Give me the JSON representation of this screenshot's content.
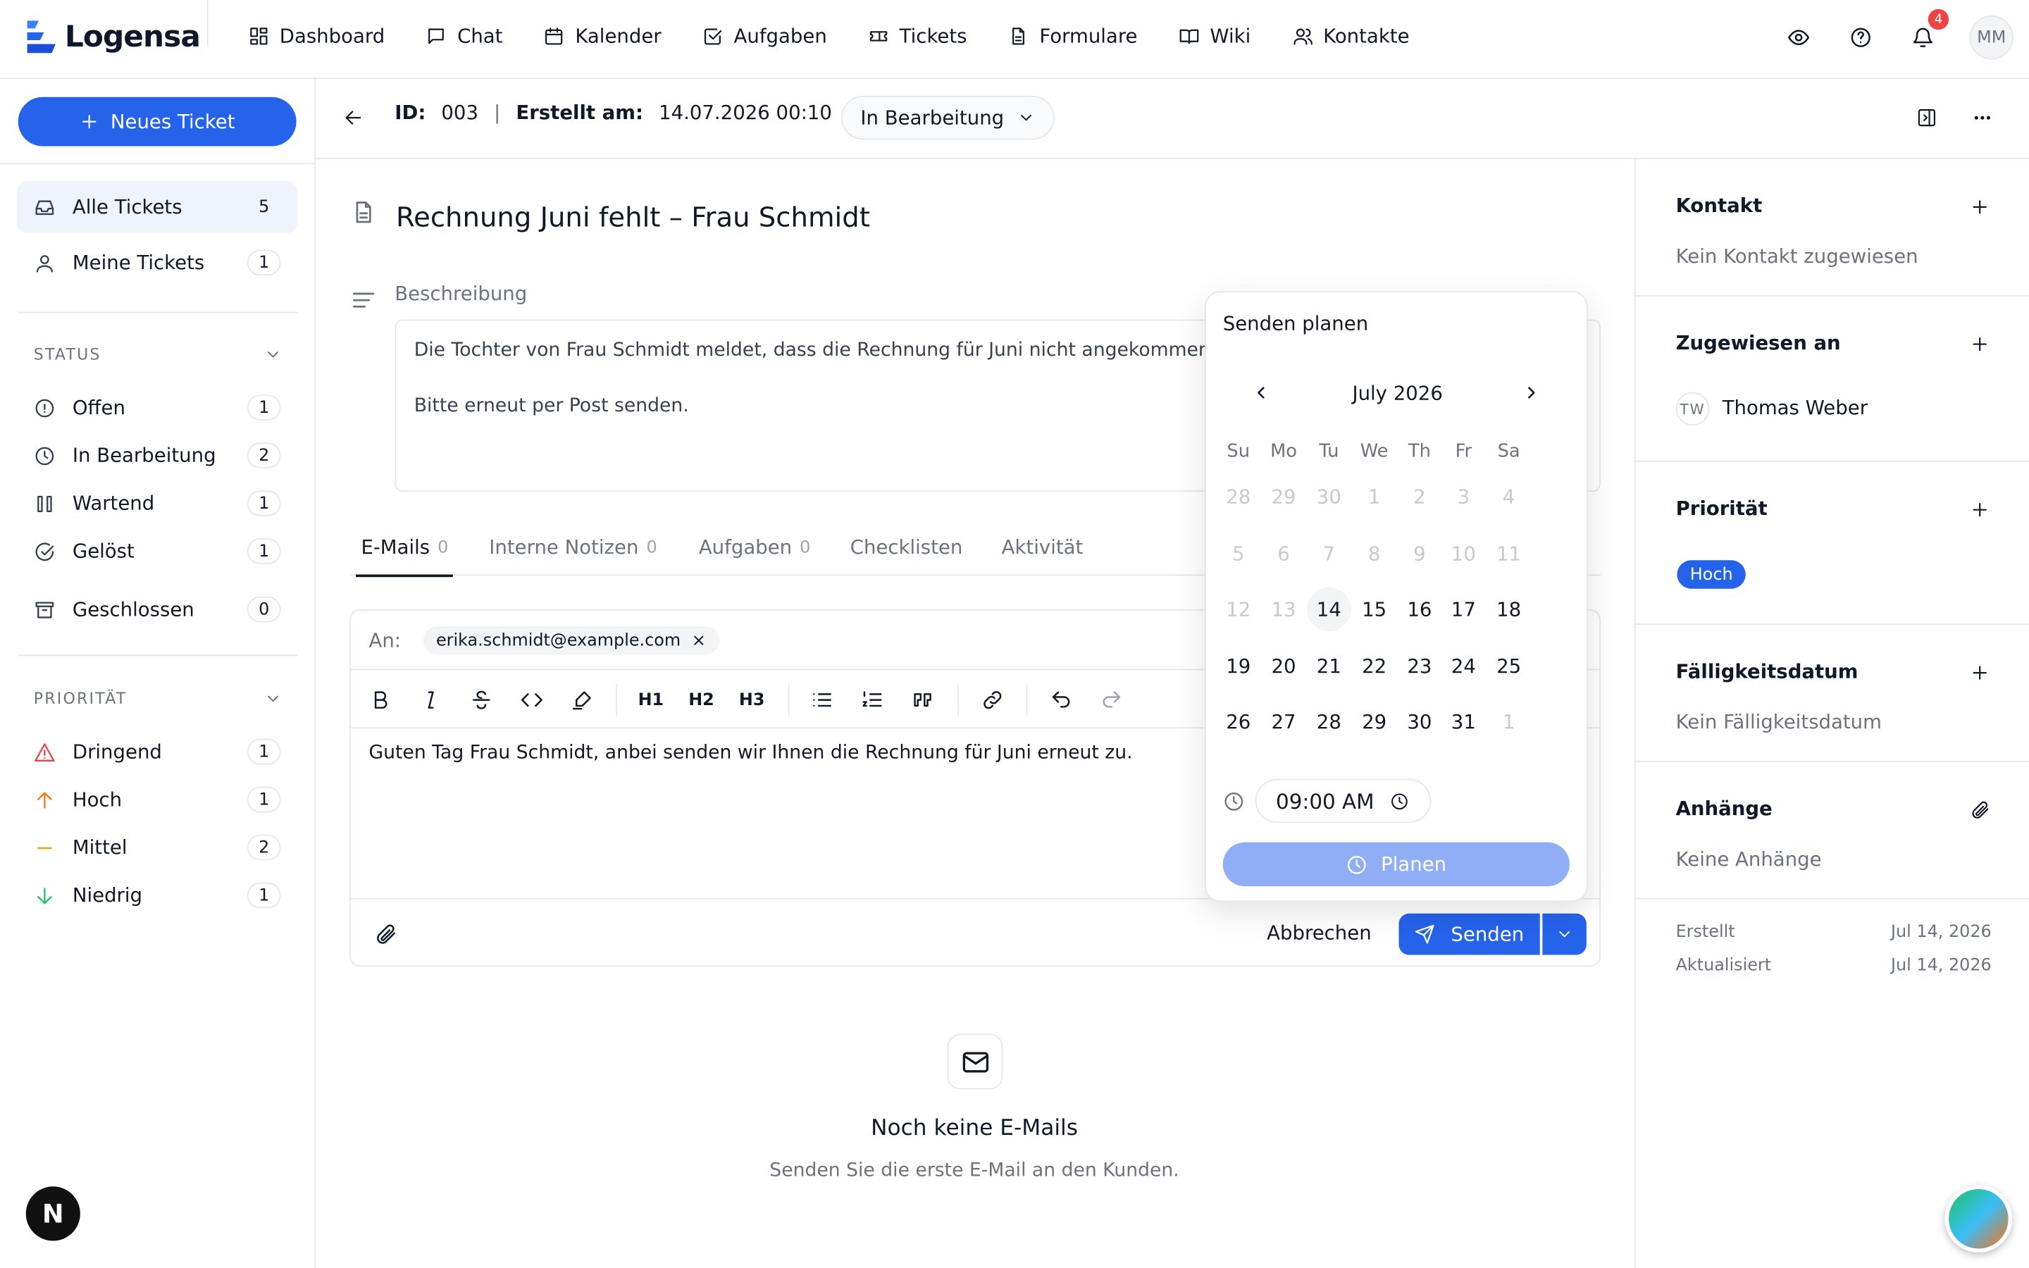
{
  "app": {
    "name": "Logensa"
  },
  "nav": [
    {
      "label": "Dashboard",
      "icon": "dashboard-icon"
    },
    {
      "label": "Chat",
      "icon": "chat-icon"
    },
    {
      "label": "Kalender",
      "icon": "calendar-icon"
    },
    {
      "label": "Aufgaben",
      "icon": "checkbox-icon"
    },
    {
      "label": "Tickets",
      "icon": "ticket-icon"
    },
    {
      "label": "Formulare",
      "icon": "form-icon"
    },
    {
      "label": "Wiki",
      "icon": "book-icon"
    },
    {
      "label": "Kontakte",
      "icon": "contacts-icon"
    }
  ],
  "topbar": {
    "notifications": "4",
    "user_initials": "MM"
  },
  "sidebar": {
    "new_ticket": "Neues Ticket",
    "views": [
      {
        "label": "Alle Tickets",
        "count": "5"
      },
      {
        "label": "Meine Tickets",
        "count": "1"
      }
    ],
    "status_title": "STATUS",
    "status": [
      {
        "label": "Offen",
        "count": "1"
      },
      {
        "label": "In Bearbeitung",
        "count": "2"
      },
      {
        "label": "Wartend",
        "count": "1"
      },
      {
        "label": "Gelöst",
        "count": "1"
      },
      {
        "label": "Geschlossen",
        "count": "0"
      }
    ],
    "priority_title": "PRIORITÄT",
    "priority": [
      {
        "label": "Dringend",
        "count": "1",
        "color": "#ef4444"
      },
      {
        "label": "Hoch",
        "count": "1",
        "color": "#f97316"
      },
      {
        "label": "Mittel",
        "count": "2",
        "color": "#f59e0b"
      },
      {
        "label": "Niedrig",
        "count": "1",
        "color": "#22c55e"
      }
    ]
  },
  "ticket": {
    "id_label": "ID:",
    "id": "003",
    "created_label": "Erstellt am:",
    "created": "14.07.2026 00:10",
    "status": "In Bearbeitung",
    "title": "Rechnung Juni fehlt – Frau Schmidt",
    "description_label": "Beschreibung",
    "description_line1": "Die Tochter von Frau Schmidt meldet, dass die Rechnung für Juni nicht angekommen ist.",
    "description_line2": "Bitte erneut per Post senden."
  },
  "tabs": [
    {
      "label": "E-Mails",
      "count": "0"
    },
    {
      "label": "Interne Notizen",
      "count": "0"
    },
    {
      "label": "Aufgaben",
      "count": "0"
    },
    {
      "label": "Checklisten",
      "count": ""
    },
    {
      "label": "Aktivität",
      "count": ""
    }
  ],
  "composer": {
    "to_label": "An:",
    "recipient": "erika.schmidt@example.com",
    "body": "Guten Tag Frau Schmidt, anbei senden wir Ihnen die Rechnung für Juni erneut zu.",
    "cancel": "Abbrechen",
    "send": "Senden",
    "toolbar": {
      "h1": "H1",
      "h2": "H2",
      "h3": "H3"
    }
  },
  "empty": {
    "title": "Noch keine E-Mails",
    "subtitle": "Senden Sie die erste E-Mail an den Kunden."
  },
  "right": {
    "contact_title": "Kontakt",
    "contact_value": "Kein Kontakt zugewiesen",
    "assigned_title": "Zugewiesen an",
    "assigned_initials": "TW",
    "assigned_name": "Thomas Weber",
    "priority_title": "Priorität",
    "priority_value": "Hoch",
    "due_title": "Fälligkeitsdatum",
    "due_value": "Kein Fälligkeitsdatum",
    "attachments_title": "Anhänge",
    "attachments_value": "Keine Anhänge",
    "created_label": "Erstellt",
    "created_value": "Jul 14, 2026",
    "updated_label": "Aktualisiert",
    "updated_value": "Jul 14, 2026"
  },
  "schedule": {
    "title": "Senden planen",
    "month": "July 2026",
    "weekdays": [
      "Su",
      "Mo",
      "Tu",
      "We",
      "Th",
      "Fr",
      "Sa"
    ],
    "weeks": [
      [
        "28",
        "29",
        "30",
        "1",
        "2",
        "3",
        "4"
      ],
      [
        "5",
        "6",
        "7",
        "8",
        "9",
        "10",
        "11"
      ],
      [
        "12",
        "13",
        "14",
        "15",
        "16",
        "17",
        "18"
      ],
      [
        "19",
        "20",
        "21",
        "22",
        "23",
        "24",
        "25"
      ],
      [
        "26",
        "27",
        "28",
        "29",
        "30",
        "31",
        "1"
      ]
    ],
    "selected_day": "14",
    "time": "09:00 AM",
    "plan_button": "Planen"
  },
  "corner": {
    "dev_badge": "N"
  }
}
